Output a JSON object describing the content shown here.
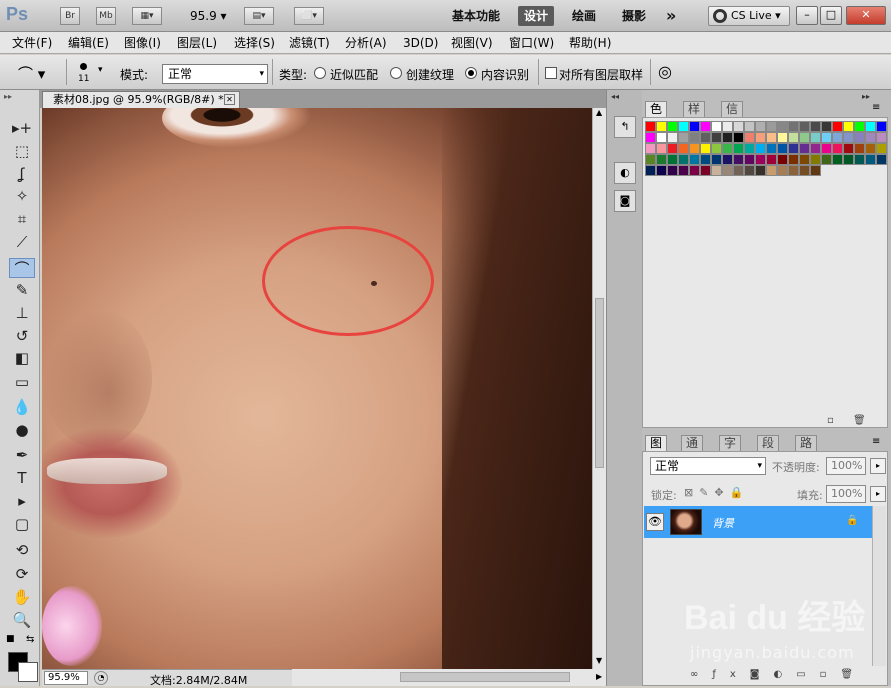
{
  "appbar": {
    "logo": "Ps",
    "bridge": "Br",
    "minibridge": "Mb",
    "zoom": "95.9",
    "workspaces": [
      "基本功能",
      "设计",
      "绘画",
      "摄影"
    ],
    "active_workspace": "设计",
    "more": "»",
    "cs_live": "CS Live",
    "win_minimize": "–",
    "win_restore": "□",
    "win_close": "✕"
  },
  "menubar": {
    "items": [
      "文件(F)",
      "编辑(E)",
      "图像(I)",
      "图层(L)",
      "选择(S)",
      "滤镜(T)",
      "分析(A)",
      "3D(D)",
      "视图(V)",
      "窗口(W)",
      "帮助(H)"
    ]
  },
  "options": {
    "brush_size": "11",
    "mode_label": "模式:",
    "mode_value": "正常",
    "type_label": "类型:",
    "type_options": [
      "近似匹配",
      "创建纹理",
      "内容识别"
    ],
    "type_selected": "内容识别",
    "sample_all_layers": "对所有图层取样",
    "sample_all_checked": false
  },
  "document": {
    "tab_title": "素材08.jpg @ 95.9%(RGB/8#) *",
    "close": "✕"
  },
  "status": {
    "zoom": "95.9%",
    "doc_size": "文档:2.84M/2.84M"
  },
  "tools": [
    {
      "name": "move-tool",
      "glyph": "▸+"
    },
    {
      "name": "marquee-tool",
      "glyph": "⬚"
    },
    {
      "name": "lasso-tool",
      "glyph": "ʆ"
    },
    {
      "name": "quick-select-tool",
      "glyph": "✧"
    },
    {
      "name": "crop-tool",
      "glyph": "⌗"
    },
    {
      "name": "eyedropper-tool",
      "glyph": "⟋"
    },
    {
      "name": "spot-healing-brush-tool",
      "glyph": "⌒"
    },
    {
      "name": "brush-tool",
      "glyph": "✎"
    },
    {
      "name": "clone-stamp-tool",
      "glyph": "⊥"
    },
    {
      "name": "history-brush-tool",
      "glyph": "↺"
    },
    {
      "name": "eraser-tool",
      "glyph": "◧"
    },
    {
      "name": "gradient-tool",
      "glyph": "▭"
    },
    {
      "name": "blur-tool",
      "glyph": "💧"
    },
    {
      "name": "dodge-tool",
      "glyph": "●"
    },
    {
      "name": "pen-tool",
      "glyph": "✒"
    },
    {
      "name": "type-tool",
      "glyph": "T"
    },
    {
      "name": "path-select-tool",
      "glyph": "▸"
    },
    {
      "name": "shape-tool",
      "glyph": "▢"
    },
    {
      "name": "3d-rotate-tool",
      "glyph": "⟲"
    },
    {
      "name": "3d-orbit-tool",
      "glyph": "⟳"
    },
    {
      "name": "hand-tool",
      "glyph": "✋"
    },
    {
      "name": "zoom-tool",
      "glyph": "🔍"
    }
  ],
  "active_tool": "spot-healing-brush-tool",
  "swatches_panel": {
    "tabs": [
      "色板",
      "样式",
      "信息"
    ],
    "active": "色板",
    "colors": [
      "#ff0000",
      "#ffff00",
      "#00ff00",
      "#00ffff",
      "#0000ff",
      "#ff00ff",
      "#ffffff",
      "#ebebeb",
      "#d7d7d7",
      "#c3c3c3",
      "#afafaf",
      "#9b9b9b",
      "#878787",
      "#737373",
      "#5f5f5f",
      "#4b4b4b",
      "#373737",
      "#ff0000",
      "#ffff00",
      "#00ff00",
      "#00ffff",
      "#0000ff",
      "#ff00ff",
      "#ffffff",
      "#f0f0f0",
      "#a0a0a0",
      "#808080",
      "#606060",
      "#404040",
      "#202020",
      "#000000",
      "#ee7f6d",
      "#f5a07a",
      "#f9be87",
      "#fff79a",
      "#c4df9b",
      "#8ec98b",
      "#7accc8",
      "#6dcff6",
      "#7ea7d8",
      "#8493ca",
      "#8781bd",
      "#a187be",
      "#bd8cbf",
      "#f49ac1",
      "#f6989d",
      "#ed1c24",
      "#f26522",
      "#f7941d",
      "#fff200",
      "#8dc63f",
      "#39b54a",
      "#00a651",
      "#00a99d",
      "#00aeef",
      "#0072bc",
      "#0054a6",
      "#2e3192",
      "#662d91",
      "#92278f",
      "#ec008c",
      "#ed145b",
      "#9e0b0f",
      "#a0410d",
      "#a36209",
      "#aba000",
      "#598527",
      "#1a7b30",
      "#007236",
      "#00746b",
      "#0076a3",
      "#004b80",
      "#003471",
      "#1b1464",
      "#440e62",
      "#630460",
      "#9e005d",
      "#9e0039",
      "#790000",
      "#7b2e00",
      "#7d4900",
      "#827b00",
      "#406618",
      "#005e20",
      "#005826",
      "#005952",
      "#005b7f",
      "#003663",
      "#002157",
      "#0d004c",
      "#32004b",
      "#4b0049",
      "#7b0046",
      "#7a0026",
      "#c7b299",
      "#998675",
      "#736357",
      "#534741",
      "#37302a",
      "#c69c6d",
      "#a67c52",
      "#8c6239",
      "#754c24",
      "#603913"
    ]
  },
  "layers_panel": {
    "tabs": [
      "图层",
      "通道",
      "字符",
      "段落",
      "路径"
    ],
    "active": "图层",
    "blend_mode": "正常",
    "opacity_label": "不透明度:",
    "opacity": "100%",
    "lock_label": "锁定:",
    "fill_label": "填充:",
    "fill": "100%",
    "layer_name": "背景"
  },
  "watermark": {
    "brand": "Bai du 经验",
    "url": "jingyan.baidu.com"
  }
}
